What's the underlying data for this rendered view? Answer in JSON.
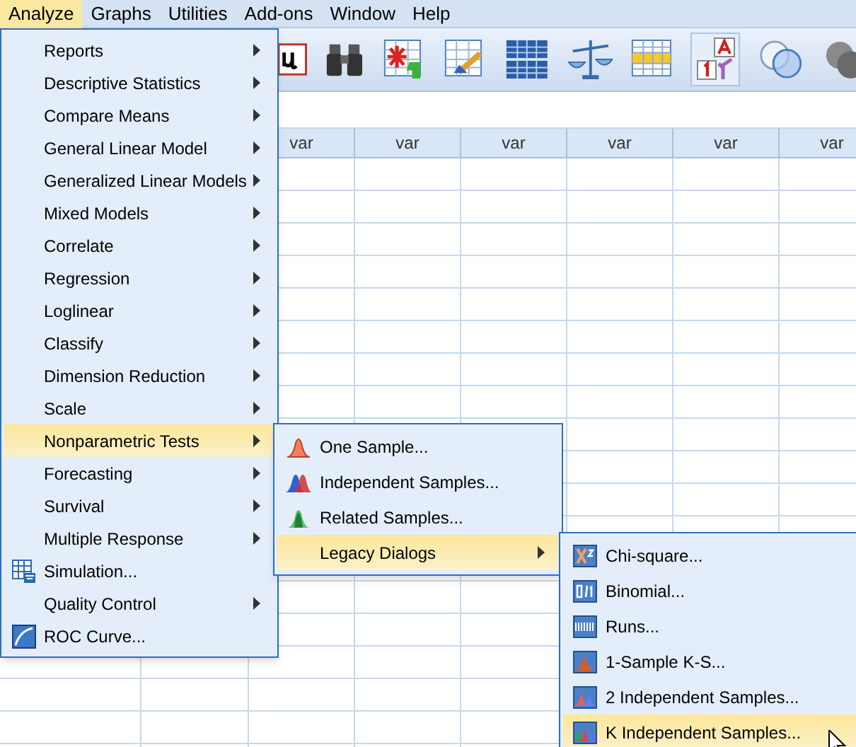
{
  "menu_bar": [
    {
      "label": "Analyze",
      "selected": true
    },
    {
      "label": "Graphs",
      "selected": false
    },
    {
      "label": "Utilities",
      "selected": false
    },
    {
      "label": "Add-ons",
      "selected": false
    },
    {
      "label": "Window",
      "selected": false
    },
    {
      "label": "Help",
      "selected": false
    }
  ],
  "grid": {
    "columns": [
      "var",
      "var",
      "var",
      "var",
      "var",
      "var"
    ]
  },
  "analyze_menu": {
    "items": [
      {
        "label": "Reports",
        "kind": "submenu",
        "selected": false
      },
      {
        "label": "Descriptive Statistics",
        "kind": "submenu",
        "selected": false
      },
      {
        "label": "Compare Means",
        "kind": "submenu",
        "selected": false
      },
      {
        "label": "General Linear Model",
        "kind": "submenu",
        "selected": false
      },
      {
        "label": "Generalized Linear Models",
        "kind": "submenu",
        "selected": false
      },
      {
        "label": "Mixed Models",
        "kind": "submenu",
        "selected": false
      },
      {
        "label": "Correlate",
        "kind": "submenu",
        "selected": false
      },
      {
        "label": "Regression",
        "kind": "submenu",
        "selected": false
      },
      {
        "label": "Loglinear",
        "kind": "submenu",
        "selected": false
      },
      {
        "label": "Classify",
        "kind": "submenu",
        "selected": false
      },
      {
        "label": "Dimension Reduction",
        "kind": "submenu",
        "selected": false
      },
      {
        "label": "Scale",
        "kind": "submenu",
        "selected": false
      },
      {
        "label": "Nonparametric Tests",
        "kind": "submenu",
        "selected": true
      },
      {
        "label": "Forecasting",
        "kind": "submenu",
        "selected": false
      },
      {
        "label": "Survival",
        "kind": "submenu",
        "selected": false
      },
      {
        "label": "Multiple Response",
        "kind": "submenu",
        "selected": false
      },
      {
        "label": "Simulation...",
        "kind": "command",
        "selected": false
      },
      {
        "label": "Quality Control",
        "kind": "submenu",
        "selected": false
      },
      {
        "label": "ROC Curve...",
        "kind": "command",
        "selected": false
      }
    ]
  },
  "nonparametric_menu": {
    "items": [
      {
        "label": "One Sample...",
        "kind": "command",
        "selected": false
      },
      {
        "label": "Independent Samples...",
        "kind": "command",
        "selected": false
      },
      {
        "label": "Related Samples...",
        "kind": "command",
        "selected": false
      },
      {
        "label": "Legacy Dialogs",
        "kind": "submenu",
        "selected": true
      }
    ]
  },
  "legacy_menu": {
    "items": [
      {
        "label": "Chi-square...",
        "selected": false
      },
      {
        "label": "Binomial...",
        "selected": false
      },
      {
        "label": "Runs...",
        "selected": false
      },
      {
        "label": "1-Sample K-S...",
        "selected": false
      },
      {
        "label": "2 Independent Samples...",
        "selected": false
      },
      {
        "label": "K Independent Samples...",
        "selected": true
      }
    ]
  }
}
